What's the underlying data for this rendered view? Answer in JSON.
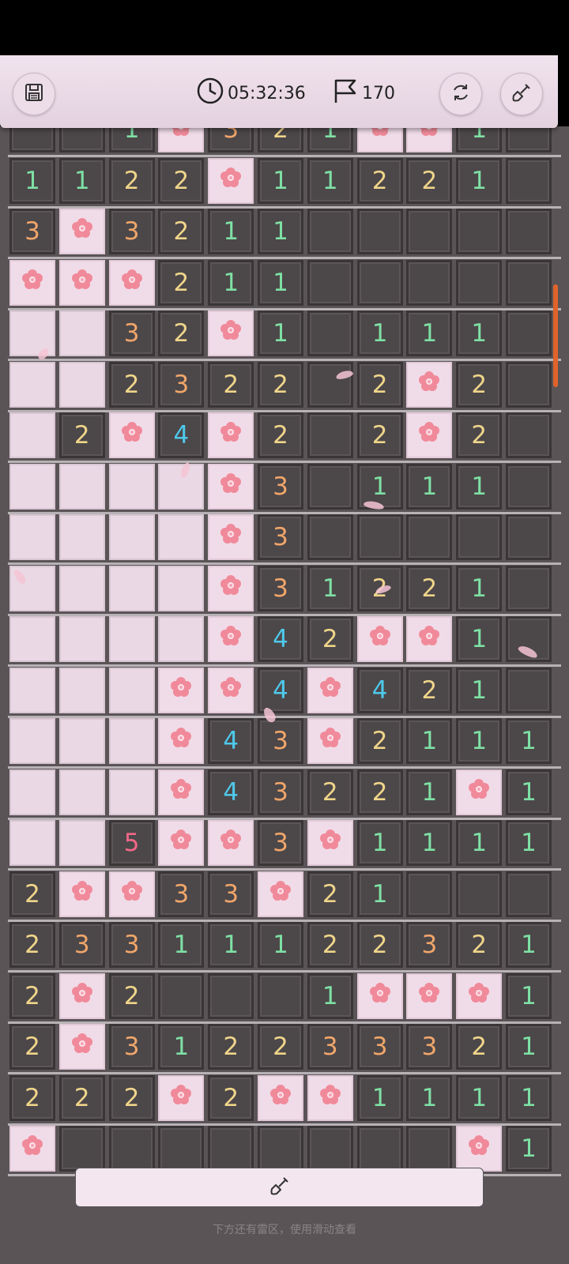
{
  "header": {
    "timer": "05:32:36",
    "flag_count": "170"
  },
  "board": {
    "rows": [
      [
        "h",
        "h",
        "1",
        "f",
        "3",
        "2",
        "1",
        "f",
        "f",
        "1",
        "h"
      ],
      [
        "1",
        "1",
        "2",
        "2",
        "f",
        "1",
        "1",
        "2",
        "2",
        "1",
        "h"
      ],
      [
        "3",
        "f",
        "3",
        "2",
        "1",
        "1",
        "h",
        "h",
        "h",
        "h",
        "h"
      ],
      [
        "f",
        "f",
        "f",
        "2",
        "1",
        "1",
        "h",
        "h",
        "h",
        "h",
        "h"
      ],
      [
        "o",
        "o",
        "3",
        "2",
        "f",
        "1",
        "h",
        "1",
        "1",
        "1",
        "h"
      ],
      [
        "o",
        "o",
        "2",
        "3",
        "2",
        "2",
        "h",
        "2",
        "f",
        "2",
        "h"
      ],
      [
        "o",
        "2",
        "f",
        "4",
        "f",
        "2",
        "h",
        "2",
        "f",
        "2",
        "h"
      ],
      [
        "o",
        "o",
        "o",
        "o",
        "f",
        "3",
        "h",
        "1",
        "1",
        "1",
        "h"
      ],
      [
        "o",
        "o",
        "o",
        "o",
        "f",
        "3",
        "h",
        "h",
        "h",
        "h",
        "h"
      ],
      [
        "o",
        "o",
        "o",
        "o",
        "f",
        "3",
        "1",
        "2",
        "2",
        "1",
        "h"
      ],
      [
        "o",
        "o",
        "o",
        "o",
        "f",
        "4",
        "2",
        "f",
        "f",
        "1",
        "h"
      ],
      [
        "o",
        "o",
        "o",
        "f",
        "f",
        "4",
        "f",
        "4",
        "2",
        "1",
        "h"
      ],
      [
        "o",
        "o",
        "o",
        "f",
        "4",
        "3",
        "f",
        "2",
        "1",
        "1",
        "1"
      ],
      [
        "o",
        "o",
        "o",
        "f",
        "4",
        "3",
        "2",
        "2",
        "1",
        "f",
        "1"
      ],
      [
        "o",
        "o",
        "5",
        "f",
        "f",
        "3",
        "f",
        "1",
        "1",
        "1",
        "1"
      ],
      [
        "2",
        "f",
        "f",
        "3",
        "3",
        "f",
        "2",
        "1",
        "h",
        "h",
        "h"
      ],
      [
        "2",
        "3",
        "3",
        "1",
        "1",
        "1",
        "2",
        "2",
        "3",
        "2",
        "1"
      ],
      [
        "2",
        "f",
        "2",
        "h",
        "h",
        "h",
        "1",
        "f",
        "f",
        "f",
        "1"
      ],
      [
        "2",
        "f",
        "3",
        "1",
        "2",
        "2",
        "3",
        "3",
        "3",
        "2",
        "1"
      ],
      [
        "2",
        "2",
        "2",
        "f",
        "2",
        "f",
        "f",
        "1",
        "1",
        "1",
        "1"
      ],
      [
        "f",
        "h",
        "h",
        "h",
        "h",
        "h",
        "h",
        "h",
        "h",
        "f",
        "1"
      ]
    ]
  },
  "footer": {
    "hint": "下方还有雷区，使用滑动查看"
  },
  "colors": {
    "accent_scroll": "#e0642a",
    "flag_flower": "#f08a9a"
  },
  "icons": {
    "save": "floppy-disk-icon",
    "timer": "clock-icon",
    "flags": "flag-icon",
    "restart": "refresh-icon",
    "dig": "shovel-icon"
  }
}
